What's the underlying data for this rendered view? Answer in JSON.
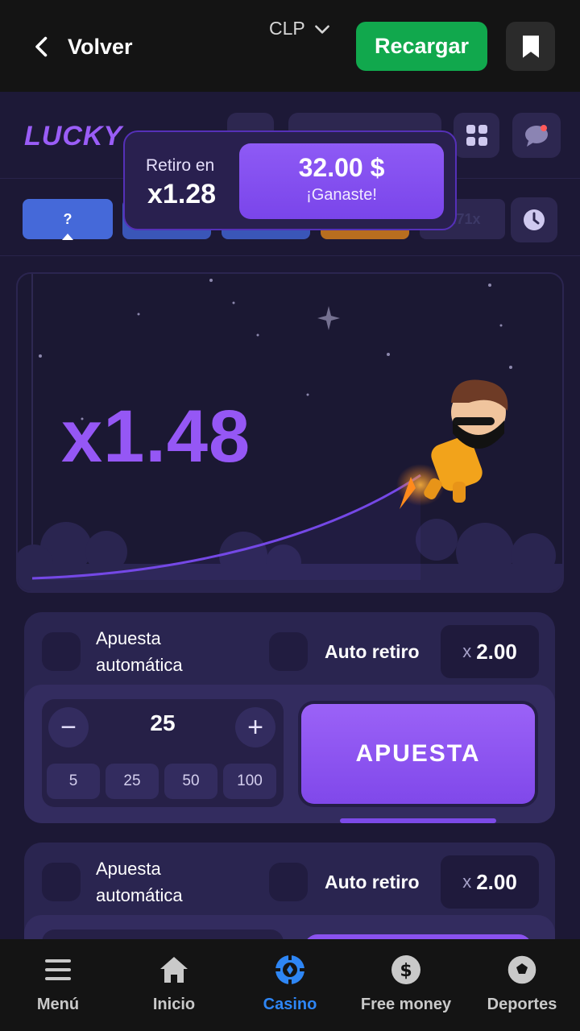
{
  "topbar": {
    "back_label": "Volver",
    "currency": "CLP",
    "recharge_label": "Recargar"
  },
  "game": {
    "logo": "LUCKY",
    "history": {
      "first_chip": "?",
      "partial_chip": "1.71x"
    }
  },
  "win_popup": {
    "label": "Retiro en",
    "multiplier": "x1.28",
    "amount": "32.00 $",
    "message": "¡Ganaste!"
  },
  "canvas": {
    "multiplier": "x1.48"
  },
  "bet_panel_1": {
    "auto_bet_line1": "Apuesta",
    "auto_bet_line2": "automática",
    "auto_cashout": "Auto retiro",
    "cashout_x": "x",
    "cashout_value": "2.00",
    "minus": "−",
    "plus": "+",
    "amount": "25",
    "quick": [
      "5",
      "25",
      "50",
      "100"
    ],
    "bet_label": "APUESTA"
  },
  "bet_panel_2": {
    "auto_bet_line1": "Apuesta",
    "auto_bet_line2": "automática",
    "auto_cashout": "Auto retiro",
    "cashout_x": "x",
    "cashout_value": "2.00"
  },
  "bottom_nav": {
    "items": [
      {
        "label": "Menú",
        "icon": "menu-icon"
      },
      {
        "label": "Inicio",
        "icon": "home-icon"
      },
      {
        "label": "Casino",
        "icon": "casino-chip-icon"
      },
      {
        "label": "Free money",
        "icon": "dollar-icon"
      },
      {
        "label": "Deportes",
        "icon": "soccer-ball-icon"
      }
    ],
    "active_color": "#2e86f5"
  }
}
